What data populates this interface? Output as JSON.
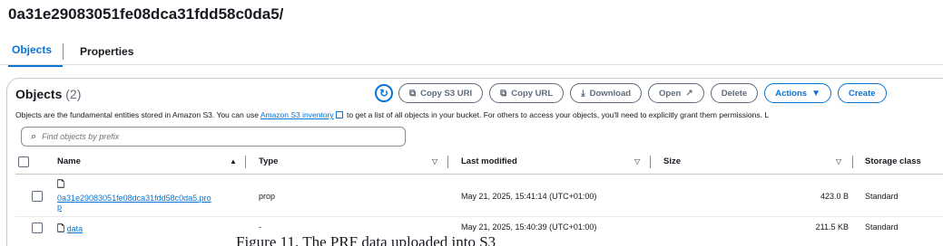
{
  "page": {
    "title": "0a31e29083051fe08dca31fdd58c0da5/"
  },
  "tabs": [
    {
      "label": "Objects",
      "active": true
    },
    {
      "label": "Properties",
      "active": false
    }
  ],
  "objects_panel": {
    "title": "Objects",
    "count": "(2)",
    "description_before": "Objects are the fundamental entities stored in Amazon S3. You can use ",
    "description_link": "Amazon S3 inventory",
    "description_after": " to get a list of all objects in your bucket. For others to access your objects, you'll need to explicitly grant them permissions. L"
  },
  "toolbar": {
    "copy_s3_uri": "Copy S3 URI",
    "copy_url": "Copy URL",
    "download": "Download",
    "open": "Open",
    "delete": "Delete",
    "actions": "Actions",
    "create": "Create"
  },
  "search": {
    "placeholder": "Find objects by prefix"
  },
  "table": {
    "headers": {
      "name": "Name",
      "type": "Type",
      "last_modified": "Last modified",
      "size": "Size",
      "storage_class": "Storage class"
    },
    "rows": [
      {
        "name_line1": "0a31e29083051fe08dca31fdd58c0da5.pro",
        "name_line2": "p",
        "type": "prop",
        "last_modified": "May 21, 2025, 15:41:14 (UTC+01:00)",
        "size": "423.0 B",
        "storage_class": "Standard"
      },
      {
        "name": "data",
        "type": "-",
        "last_modified": "May 21, 2025, 15:40:39 (UTC+01:00)",
        "size": "211.5 KB",
        "storage_class": "Standard"
      }
    ]
  },
  "caption": "Figure 11. The PRF data uploaded into S3"
}
